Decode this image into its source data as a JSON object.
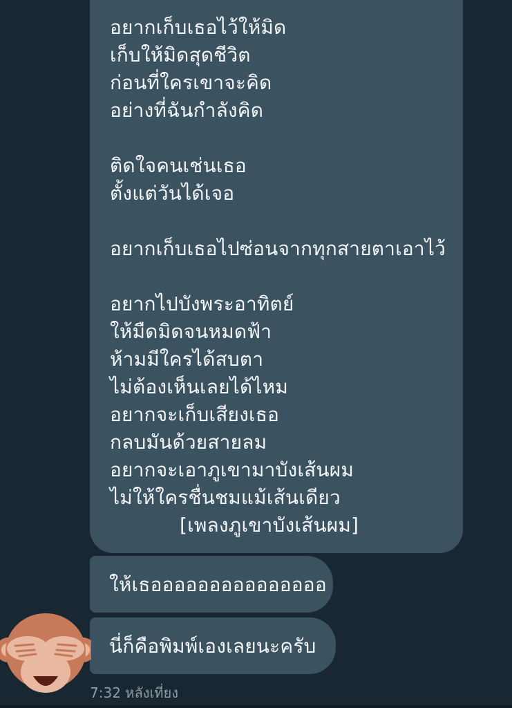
{
  "messages": {
    "lyrics": {
      "lines": [
        "อยากเก็บเธอไว้ให้มิด",
        "เก็บให้มิดสุดชีวิต",
        "ก่อนที่ใครเขาจะคิด",
        "อย่างที่ฉันกำลังคิด",
        "",
        "ติดใจคนเช่นเธอ",
        "ตั้งแต่วันได้เจอ",
        "",
        "อยากเก็บเธอไปซ่อนจากทุกสายตาเอาไว้",
        "",
        "อยากไปบังพระอาทิตย์",
        "ให้มืดมิดจนหมดฟ้า",
        "ห้ามมีใครได้สบตา",
        "ไม่ต้องเห็นเลยได้ไหม",
        "อยากจะเก็บเสียงเธอ",
        "กลบมันด้วยสายลม",
        "อยากจะเอาภูเขามาบังเส้นผม",
        "ไม่ให้ใครชื่นชมแม้เส้นเดียว"
      ],
      "credit": "[เพลงภูเขาบังเส้นผม]"
    },
    "message_2": "ให้เธอออออออออออออออ",
    "message_3": "นี่ก็คือพิมพ์เองเลยนะครับ",
    "timestamp": "7:32 หลังเที่ยง"
  },
  "sender": {
    "avatar_icon": "see-no-evil-monkey-icon"
  },
  "colors": {
    "background": "#192733",
    "bubble": "#3b5260",
    "text": "#f3f6f8",
    "timestamp": "#8f9ba3"
  }
}
